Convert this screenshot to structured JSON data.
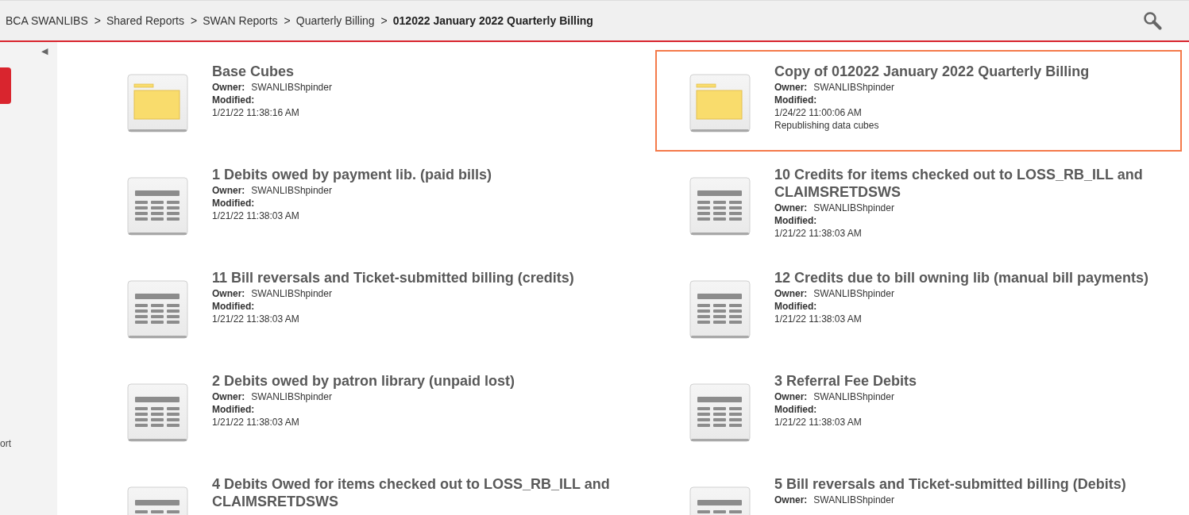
{
  "breadcrumbs": [
    {
      "label": "BCA SWANLIBS",
      "current": false
    },
    {
      "label": "Shared Reports",
      "current": false
    },
    {
      "label": "SWAN Reports",
      "current": false
    },
    {
      "label": "Quarterly Billing",
      "current": false
    },
    {
      "label": "012022 January 2022 Quarterly Billing",
      "current": true
    }
  ],
  "separator": ">",
  "sidebar": {
    "collapse_glyph": "◀",
    "cut_label": "ort"
  },
  "items": [
    {
      "kind": "folder",
      "title": "Base Cubes",
      "owner_label": "Owner:",
      "owner": "SWANLIBShpinder",
      "modified_label": "Modified:",
      "modified": "1/21/22 11:38:16 AM",
      "selected": false
    },
    {
      "kind": "folder",
      "title": "Copy of 012022 January 2022 Quarterly Billing",
      "owner_label": "Owner:",
      "owner": "SWANLIBShpinder",
      "modified_label": "Modified:",
      "modified": "1/24/22 11:00:06 AM",
      "description": "Republishing data cubes",
      "selected": true
    },
    {
      "kind": "report",
      "title": "1 Debits owed by payment lib. (paid bills)",
      "owner_label": "Owner:",
      "owner": "SWANLIBShpinder",
      "modified_label": "Modified:",
      "modified": "1/21/22 11:38:03 AM",
      "selected": false
    },
    {
      "kind": "report",
      "title": "10 Credits for items checked out to LOSS_RB_ILL and CLAIMSRETDSWS",
      "owner_label": "Owner:",
      "owner": "SWANLIBShpinder",
      "modified_label": "Modified:",
      "modified": "1/21/22 11:38:03 AM",
      "selected": false
    },
    {
      "kind": "report",
      "title": "11 Bill reversals and Ticket-submitted billing (credits)",
      "owner_label": "Owner:",
      "owner": "SWANLIBShpinder",
      "modified_label": "Modified:",
      "modified": "1/21/22 11:38:03 AM",
      "selected": false
    },
    {
      "kind": "report",
      "title": "12 Credits due to bill owning lib (manual bill payments)",
      "owner_label": "Owner:",
      "owner": "SWANLIBShpinder",
      "modified_label": "Modified:",
      "modified": "1/21/22 11:38:03 AM",
      "selected": false
    },
    {
      "kind": "report",
      "title": "2 Debits owed by patron library (unpaid lost)",
      "owner_label": "Owner:",
      "owner": "SWANLIBShpinder",
      "modified_label": "Modified:",
      "modified": "1/21/22 11:38:03 AM",
      "selected": false
    },
    {
      "kind": "report",
      "title": "3 Referral Fee Debits",
      "owner_label": "Owner:",
      "owner": "SWANLIBShpinder",
      "modified_label": "Modified:",
      "modified": "1/21/22 11:38:03 AM",
      "selected": false
    },
    {
      "kind": "report",
      "title": "4 Debits Owed for items checked out to LOSS_RB_ILL and CLAIMSRETDSWS",
      "selected": false
    },
    {
      "kind": "report",
      "title": "5 Bill reversals and Ticket-submitted billing (Debits)",
      "owner_label": "Owner:",
      "owner": "SWANLIBShpinder",
      "selected": false
    }
  ]
}
